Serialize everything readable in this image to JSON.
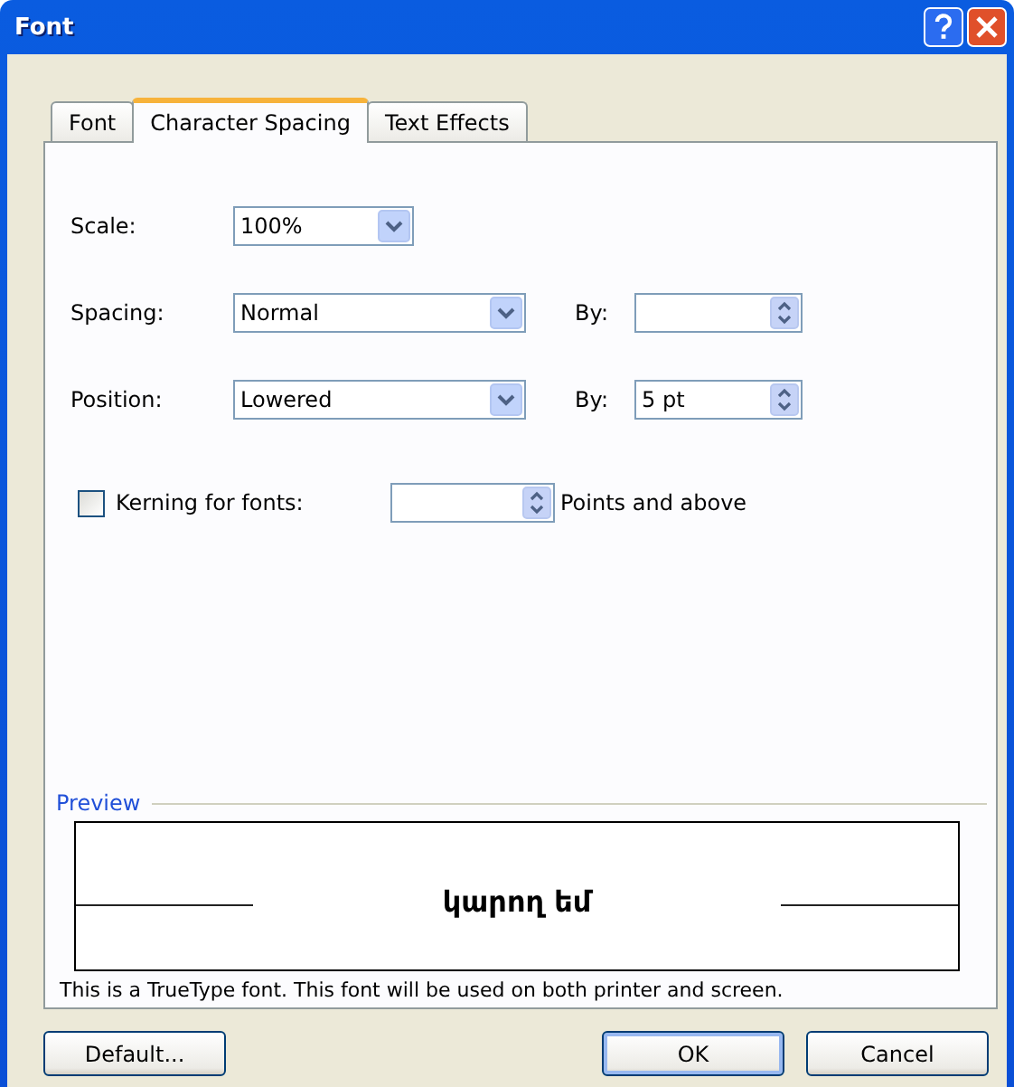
{
  "window": {
    "title": "Font"
  },
  "tabs": [
    {
      "label": "Font",
      "selected": false
    },
    {
      "label": "Character Spacing",
      "selected": true
    },
    {
      "label": "Text Effects",
      "selected": false
    }
  ],
  "fields": [
    {
      "label": "Scale:",
      "value": "100%"
    },
    {
      "label": "Spacing:",
      "value": "Normal",
      "by": {
        "label": "By:"
      }
    },
    {
      "label": "Position:",
      "value": "Lowered",
      "by": {
        "label": "By:",
        "value": "5 pt"
      }
    }
  ],
  "kerning": {
    "label": "Kerning for fonts:",
    "checked": false,
    "suffix": "Points and above"
  },
  "preview": {
    "label": "Preview",
    "sample": "կարող եմ",
    "note": "This is a TrueType font. This font will be used on both printer and screen."
  },
  "buttons": [
    {
      "label": "Default...",
      "default": false
    },
    {
      "label": "OK",
      "default": true
    },
    {
      "label": "Cancel",
      "default": false
    }
  ]
}
